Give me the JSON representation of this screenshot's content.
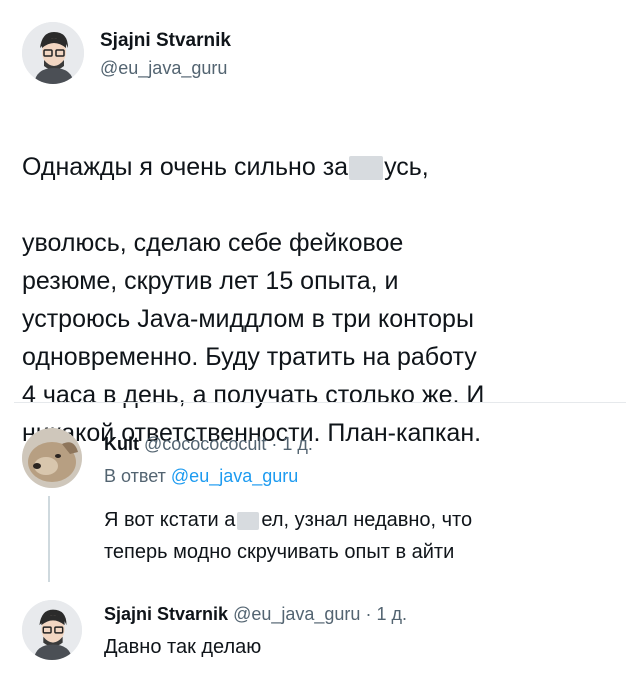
{
  "main_tweet": {
    "author_name": "Sjajni Stvarnik",
    "author_handle": "@eu_java_guru",
    "text_line1_a": "Однажды я очень сильно за",
    "text_line1_b": "усь,",
    "text_rest": "уволюсь, сделаю себе фейковое\nрезюме, скрутив лет 15 опыта, и\nустроюсь Java-миддлом в три конторы\nодновременно. Буду тратить на работу\n4 часа в день, а получать столько же. И\nникакой ответственности. План-капкан."
  },
  "reply1": {
    "author_name": "Kult",
    "author_handle": "@cococococult",
    "separator": "·",
    "time": "1 д.",
    "reply_to_prefix": "В ответ",
    "reply_to_handle": "@eu_java_guru",
    "text_line1_a": "Я вот кстати а",
    "text_line1_b": "ел, узнал недавно, что",
    "text_line2": "теперь модно скручивать опыт в айти"
  },
  "reply2": {
    "author_name": "Sjajni Stvarnik",
    "author_handle": "@eu_java_guru",
    "separator": "·",
    "time": "1 д.",
    "text": "Давно так делаю"
  },
  "colors": {
    "text": "#0f1419",
    "muted": "#536471",
    "link": "#1d9bf0",
    "divider": "#e6e9ec"
  }
}
